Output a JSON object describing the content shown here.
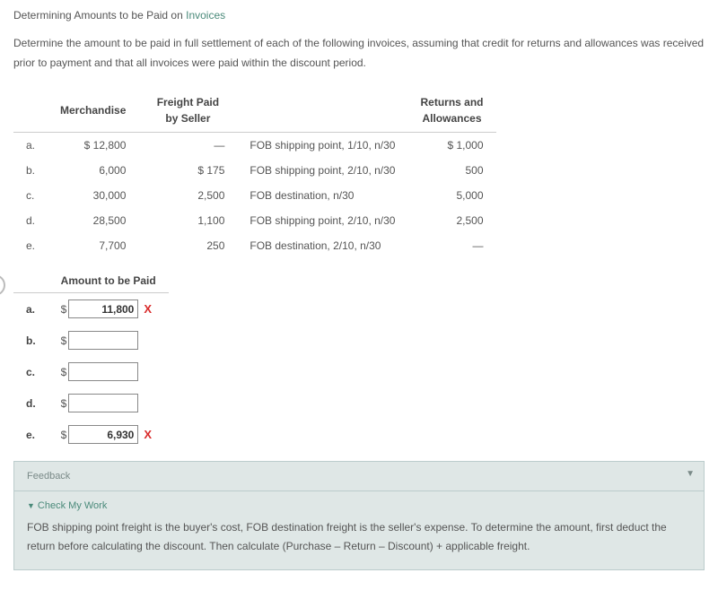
{
  "title_prefix": "Determining Amounts to be Paid on ",
  "title_link": "Invoices",
  "intro": "Determine the amount to be paid in full settlement of each of the following invoices, assuming that credit for returns and allowances was received prior to payment and that all invoices were paid within the discount period.",
  "headers": {
    "merchandise": "Merchandise",
    "freight": "Freight Paid by Seller",
    "terms": "",
    "returns": "Returns and Allowances"
  },
  "rows": [
    {
      "label": "a.",
      "merch": "$ 12,800",
      "freight": "—",
      "terms": "FOB shipping point, 1/10, n/30",
      "returns": "$ 1,000"
    },
    {
      "label": "b.",
      "merch": "6,000",
      "freight": "$ 175",
      "terms": "FOB shipping point, 2/10, n/30",
      "returns": "500"
    },
    {
      "label": "c.",
      "merch": "30,000",
      "freight": "2,500",
      "terms": "FOB destination, n/30",
      "returns": "5,000"
    },
    {
      "label": "d.",
      "merch": "28,500",
      "freight": "1,100",
      "terms": "FOB shipping point, 2/10, n/30",
      "returns": "2,500"
    },
    {
      "label": "e.",
      "merch": "7,700",
      "freight": "250",
      "terms": "FOB destination, 2/10, n/30",
      "returns": "—"
    }
  ],
  "amount_header": "Amount to be Paid",
  "answers": [
    {
      "label": "a.",
      "value": "11,800",
      "wrong": true
    },
    {
      "label": "b.",
      "value": "",
      "wrong": false
    },
    {
      "label": "c.",
      "value": "",
      "wrong": false
    },
    {
      "label": "d.",
      "value": "",
      "wrong": false
    },
    {
      "label": "e.",
      "value": "6,930",
      "wrong": true
    }
  ],
  "dollar": "$",
  "mark_x": "X",
  "feedback": {
    "title": "Feedback",
    "check": "Check My Work",
    "body": "FOB shipping point freight is the buyer's cost, FOB destination freight is the seller's expense. To determine the amount, first deduct the return before calculating the discount. Then calculate (Purchase – Return – Discount) + applicable freight."
  }
}
